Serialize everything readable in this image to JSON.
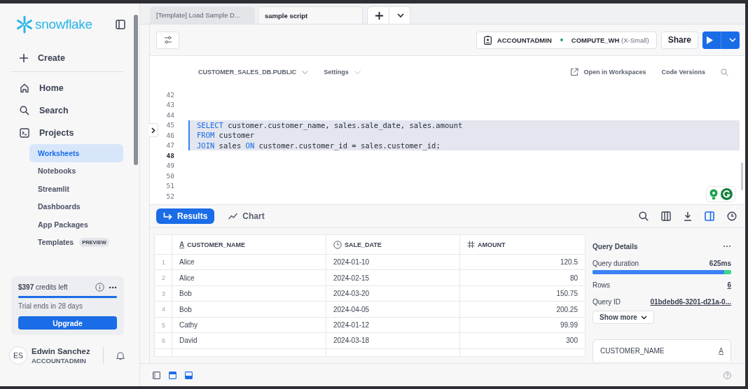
{
  "sidebar": {
    "logo": "snowflake",
    "create": "Create",
    "nav": [
      {
        "label": "Home",
        "kind": "home"
      },
      {
        "label": "Search",
        "kind": "search"
      },
      {
        "label": "Projects",
        "kind": "projects"
      }
    ],
    "sub_items": [
      {
        "label": "Worksheets",
        "selected": true
      },
      {
        "label": "Notebooks",
        "selected": false
      },
      {
        "label": "Streamlit",
        "selected": false
      },
      {
        "label": "Dashboards",
        "selected": false
      },
      {
        "label": "App Packages",
        "selected": false
      },
      {
        "label": "Templates",
        "badge": "PREVIEW",
        "selected": false
      }
    ],
    "credits": {
      "text": "**$397** credits left",
      "level": 1,
      "trial": "Trial ends in 28 days",
      "button": "Upgrade"
    },
    "user": {
      "initials": "ES",
      "name": "Edwin Sanchez",
      "role": "ACCOUNTADMIN"
    }
  },
  "tabs": [
    {
      "label": "[Template] Load Sample D...",
      "selected": false
    },
    {
      "label": "sample script",
      "selected": true
    }
  ],
  "toolbar": {
    "role": "ACCOUNTADMIN",
    "warehouse": "COMPUTE_WH",
    "size": "(X-Small)",
    "share": "Share"
  },
  "editor_header": {
    "context": "CUSTOMER_SALES_DB.PUBLIC",
    "settings": "Settings",
    "open": "Open in Workspaces",
    "versions": "Code Versions"
  },
  "editor": {
    "lines": [
      {
        "number": "42",
        "selected": false,
        "current": false
      },
      {
        "number": "43",
        "selected": false,
        "current": false
      },
      {
        "number": "44",
        "selected": false,
        "current": false
      },
      {
        "number": "45",
        "selected": true,
        "current": false,
        "tokens": [
          {
            "text": "SELECT",
            "kind": "keyword"
          },
          {
            "text": " customer.customer_name, sales.sale_date, sales.amount",
            "kind": "plain"
          }
        ]
      },
      {
        "number": "46",
        "selected": true,
        "current": false,
        "tokens": [
          {
            "text": "FROM",
            "kind": "keyword"
          },
          {
            "text": " customer",
            "kind": "plain"
          }
        ]
      },
      {
        "number": "47",
        "selected": true,
        "current": false,
        "tokens": [
          {
            "text": "JOIN",
            "kind": "keyword"
          },
          {
            "text": " sales ",
            "kind": "plain"
          },
          {
            "text": "ON",
            "kind": "keyword"
          },
          {
            "text": " customer.customer_id = sales.customer_id;",
            "kind": "plain"
          }
        ]
      },
      {
        "number": "48",
        "selected": false,
        "current": true
      },
      {
        "number": "49",
        "selected": false,
        "current": false
      },
      {
        "number": "50",
        "selected": false,
        "current": false
      },
      {
        "number": "51",
        "selected": false,
        "current": false
      },
      {
        "number": "52",
        "selected": false,
        "current": false
      }
    ]
  },
  "result_tabs": [
    {
      "label": "Results",
      "kind": "results",
      "selected": true
    },
    {
      "label": "Chart",
      "kind": "chart",
      "selected": false
    }
  ],
  "table": {
    "columns": [
      {
        "label": "CUSTOMER_NAME",
        "kind": "text",
        "glyph": "A"
      },
      {
        "label": "SALE_DATE",
        "kind": "date"
      },
      {
        "label": "AMOUNT",
        "kind": "number"
      }
    ],
    "rows": [
      {
        "index": "1",
        "cells": [
          "Alice",
          "2024-01-10",
          "120.5"
        ]
      },
      {
        "index": "2",
        "cells": [
          "Alice",
          "2024-02-15",
          "80"
        ]
      },
      {
        "index": "3",
        "cells": [
          "Bob",
          "2024-03-20",
          "150.75"
        ]
      },
      {
        "index": "4",
        "cells": [
          "Bob",
          "2024-04-05",
          "200.25"
        ]
      },
      {
        "index": "5",
        "cells": [
          "Cathy",
          "2024-01-12",
          "99.99"
        ]
      },
      {
        "index": "6",
        "cells": [
          "David",
          "2024-03-18",
          "300"
        ]
      }
    ]
  },
  "details": {
    "title": "Query Details",
    "duration_label": "Query duration",
    "duration": "625ms",
    "level": 0.95,
    "rows_label": "Rows",
    "rows": "6",
    "id_label": "Query ID",
    "id": "01bdebd6-3201-d21a-0...",
    "show_more": "Show more",
    "column_card": {
      "label": "CUSTOMER_NAME",
      "glyph": "A"
    }
  }
}
